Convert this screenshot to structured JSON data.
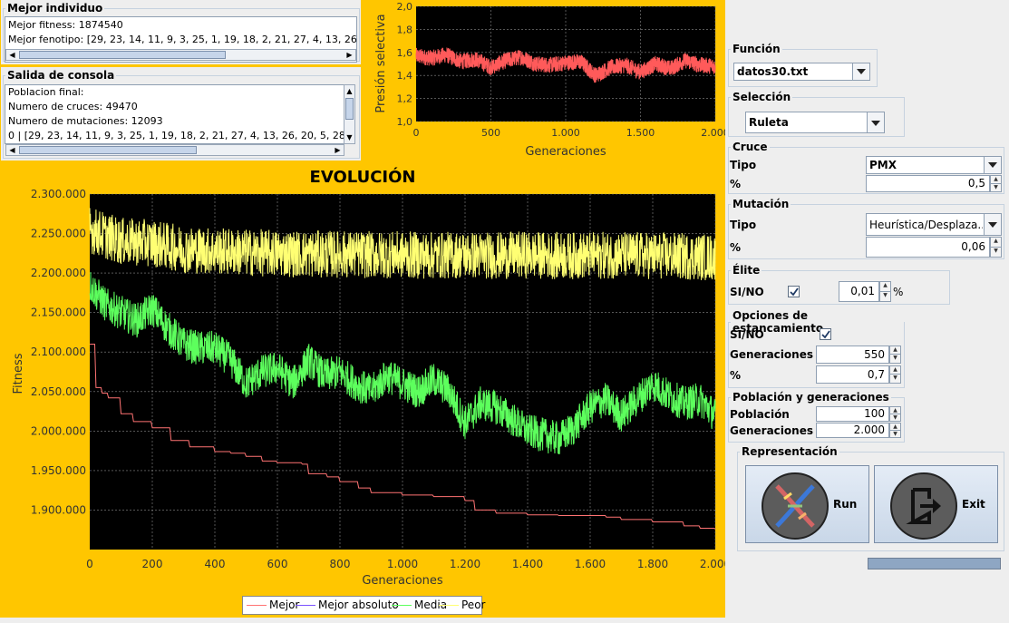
{
  "mejor_individuo": {
    "title": "Mejor individuo",
    "lines": [
      "Mejor fitness: 1874540",
      "Mejor fenotipo: [29, 23, 14, 11, 9, 3, 25, 1, 19, 18, 2, 21, 27, 4, 13, 26, 20,"
    ]
  },
  "consola": {
    "title": "Salida de consola",
    "lines": [
      "Poblacion final:",
      "Numero de cruces: 49470",
      "Numero de mutaciones: 12093",
      "0 | [29, 23, 14, 11, 9, 3, 25, 1, 19, 18, 2, 21, 27, 4, 13, 26, 20, 5, 28, 17"
    ]
  },
  "chart_data": [
    {
      "type": "line",
      "xlabel": "Generaciones",
      "ylabel": "Presión selectiva",
      "xlim": [
        0,
        2000
      ],
      "ylim": [
        1.0,
        2.0
      ],
      "xticks": [
        "0",
        "500",
        "1.000",
        "1.500",
        "2.000"
      ],
      "yticks": [
        "1,0",
        "1,2",
        "1,4",
        "1,6",
        "1,8",
        "2,0"
      ],
      "grid": true,
      "series": [
        {
          "color": "#ff5a5a",
          "x": [
            0,
            100,
            200,
            300,
            400,
            500,
            600,
            700,
            800,
            900,
            1000,
            1100,
            1200,
            1300,
            1400,
            1500,
            1600,
            1700,
            1800,
            1900,
            2000
          ],
          "y": [
            1.57,
            1.55,
            1.58,
            1.52,
            1.54,
            1.47,
            1.53,
            1.56,
            1.5,
            1.49,
            1.51,
            1.52,
            1.4,
            1.47,
            1.49,
            1.43,
            1.5,
            1.46,
            1.53,
            1.49,
            1.48
          ]
        }
      ]
    },
    {
      "type": "line",
      "title": "EVOLUCIÓN",
      "xlabel": "Generaciones",
      "ylabel": "Fitness",
      "xlim": [
        0,
        2000
      ],
      "ylim": [
        1850000,
        2300000
      ],
      "xticks": [
        "0",
        "200",
        "400",
        "600",
        "800",
        "1.000",
        "1.200",
        "1.400",
        "1.600",
        "1.800",
        "2.000"
      ],
      "yticks": [
        "1.900.000",
        "1.950.000",
        "2.000.000",
        "2.050.000",
        "2.100.000",
        "2.150.000",
        "2.200.000",
        "2.250.000",
        "2.300.000"
      ],
      "grid": true,
      "legend_position": "bottom",
      "series": [
        {
          "name": "Mejor",
          "color": "#ff7373",
          "x": [
            0,
            20,
            40,
            60,
            100,
            140,
            200,
            260,
            320,
            400,
            450,
            500,
            550,
            600,
            680,
            700,
            760,
            800,
            860,
            900,
            1000,
            1100,
            1200,
            1230,
            1300,
            1400,
            1500,
            1650,
            1700,
            1800,
            1900,
            1950,
            2000
          ],
          "y": [
            2110000,
            2055000,
            2048000,
            2042000,
            2022000,
            2012000,
            2004000,
            1988000,
            1980000,
            1974000,
            1972000,
            1968000,
            1962000,
            1960000,
            1958000,
            1946000,
            1942000,
            1936000,
            1928000,
            1922000,
            1919000,
            1917000,
            1912000,
            1900000,
            1896000,
            1894000,
            1893000,
            1891000,
            1888000,
            1885000,
            1880000,
            1877000,
            1876000
          ]
        },
        {
          "name": "Mejor absoluto",
          "color": "#7b52ff",
          "x": [],
          "y": []
        },
        {
          "name": "Media",
          "color": "#5dff5d",
          "x": [
            0,
            50,
            100,
            150,
            200,
            250,
            300,
            350,
            400,
            450,
            500,
            550,
            600,
            650,
            700,
            750,
            800,
            850,
            900,
            950,
            1000,
            1050,
            1100,
            1150,
            1200,
            1250,
            1300,
            1350,
            1400,
            1450,
            1500,
            1550,
            1600,
            1650,
            1700,
            1750,
            1800,
            1850,
            1900,
            1950,
            2000
          ],
          "y": [
            2185000,
            2160000,
            2150000,
            2140000,
            2155000,
            2130000,
            2110000,
            2105000,
            2105000,
            2090000,
            2060000,
            2075000,
            2080000,
            2060000,
            2090000,
            2070000,
            2075000,
            2060000,
            2050000,
            2070000,
            2060000,
            2050000,
            2065000,
            2050000,
            2010000,
            2035000,
            2030000,
            2015000,
            2000000,
            1995000,
            1990000,
            2005000,
            2030000,
            2040000,
            2020000,
            2040000,
            2060000,
            2045000,
            2035000,
            2040000,
            2020000
          ]
        },
        {
          "name": "Peor",
          "color": "#ffff73",
          "x": [
            0,
            100,
            200,
            300,
            400,
            500,
            600,
            700,
            800,
            900,
            1000,
            1100,
            1200,
            1300,
            1400,
            1500,
            1600,
            1700,
            1800,
            1900,
            2000
          ],
          "y": [
            2255000,
            2240000,
            2238000,
            2230000,
            2228000,
            2226000,
            2225000,
            2224000,
            2224000,
            2223000,
            2223000,
            2222000,
            2223000,
            2222000,
            2223000,
            2222000,
            2222000,
            2223000,
            2222000,
            2221000,
            2220000
          ]
        }
      ]
    }
  ],
  "funcion": {
    "title": "Función",
    "value": "datos30.txt"
  },
  "seleccion": {
    "title": "Selección",
    "value": "Ruleta"
  },
  "cruce": {
    "title": "Cruce",
    "tipo_label": "Tipo",
    "tipo_value": "PMX",
    "pct_label": "%",
    "pct_value": "0,5"
  },
  "mutacion": {
    "title": "Mutación",
    "tipo_label": "Tipo",
    "tipo_value": "Heurística/Desplaza...",
    "pct_label": "%",
    "pct_value": "0,06"
  },
  "elite": {
    "title": "Élite",
    "sino_label": "SI/NO",
    "checked": true,
    "value": "0,01",
    "pct": "%"
  },
  "estancamiento": {
    "title": "Opciones de estancamiento",
    "sino_label": "SI/NO",
    "checked": true,
    "gen_label": "Generaciones",
    "gen_value": "550",
    "pct_label": "%",
    "pct_value": "0,7"
  },
  "poblacion": {
    "title": "Población y generaciones",
    "pob_label": "Población",
    "pob_value": "100",
    "gen_label": "Generaciones",
    "gen_value": "2.000"
  },
  "representacion": {
    "title": "Representación",
    "run_label": "Run",
    "exit_label": "Exit"
  },
  "colors": {
    "panel": "#ffc600",
    "plot_bg": "#000000"
  }
}
